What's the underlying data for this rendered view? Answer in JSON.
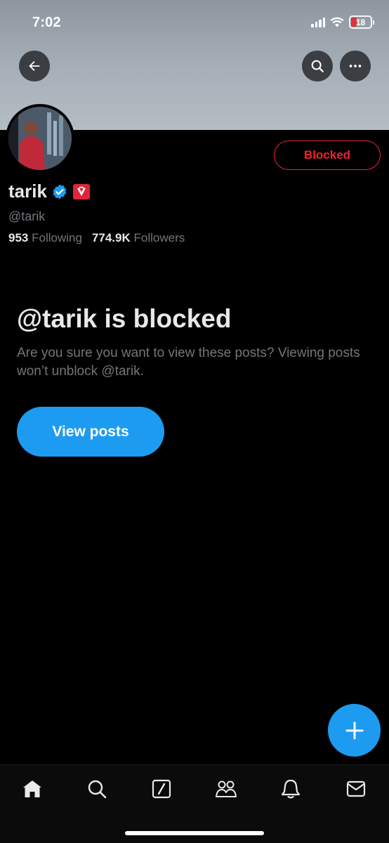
{
  "status_bar": {
    "time": "7:02",
    "battery": "18"
  },
  "profile": {
    "name": "tarik",
    "handle": "@tarik",
    "following_count": "953",
    "following_label": "Following",
    "followers_count": "774.9K",
    "followers_label": "Followers",
    "blocked_label": "Blocked"
  },
  "blocked_notice": {
    "title": "@tarik is blocked",
    "description": "Are you sure you want to view these posts? Viewing posts won’t unblock @tarik.",
    "button_label": "View posts"
  },
  "icons": {
    "back": "arrow-left-icon",
    "search": "search-icon",
    "more": "more-dots-icon",
    "verified": "verified-badge-icon",
    "affiliate": "affiliate-badge-icon",
    "compose": "plus-icon"
  },
  "tabs": [
    "home-icon",
    "explore-icon",
    "grok-icon",
    "communities-icon",
    "notifications-icon",
    "messages-icon"
  ],
  "colors": {
    "accent": "#1d9bf0",
    "blocked": "#f4212e",
    "background": "#000000",
    "secondary_text": "#71767b"
  }
}
